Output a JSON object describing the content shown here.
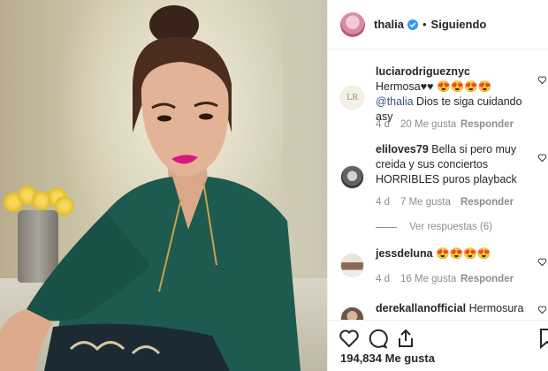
{
  "post": {
    "username": "thalia",
    "follow_status": "Siguiendo",
    "separator": "•",
    "likes_count": "194,834",
    "likes_label": "Me gusta"
  },
  "comments": [
    {
      "username": "luciarodrigueznyc",
      "text_before": " Hermosa♥♥ 😍😍😍😍 ",
      "mention": "@thalia",
      "text_after": " Dios te siga cuidando asy",
      "time": "4 d",
      "likes": "20 Me gusta",
      "reply": "Responder"
    },
    {
      "username": "eliloves79",
      "text_before": " Bella si pero muy creida y sus conciertos HORRIBLES puros playback",
      "time": "4 d",
      "likes": "7 Me gusta",
      "reply": "Responder",
      "view_replies": "Ver respuestas (6)"
    },
    {
      "username": "jessdeluna",
      "text_before": " 😍😍😍😍",
      "time": "4 d",
      "likes": "16 Me gusta",
      "reply": "Responder"
    },
    {
      "username": "derekallanofficial",
      "text_before": " Hermosura"
    }
  ],
  "icons": {
    "verified": "verified-badge-icon",
    "like": "heart-icon",
    "comment": "comment-icon",
    "share": "share-icon",
    "save": "bookmark-icon"
  },
  "colors": {
    "verified": "#3897f0",
    "mention": "#385185",
    "muted": "#8e8e8e"
  }
}
